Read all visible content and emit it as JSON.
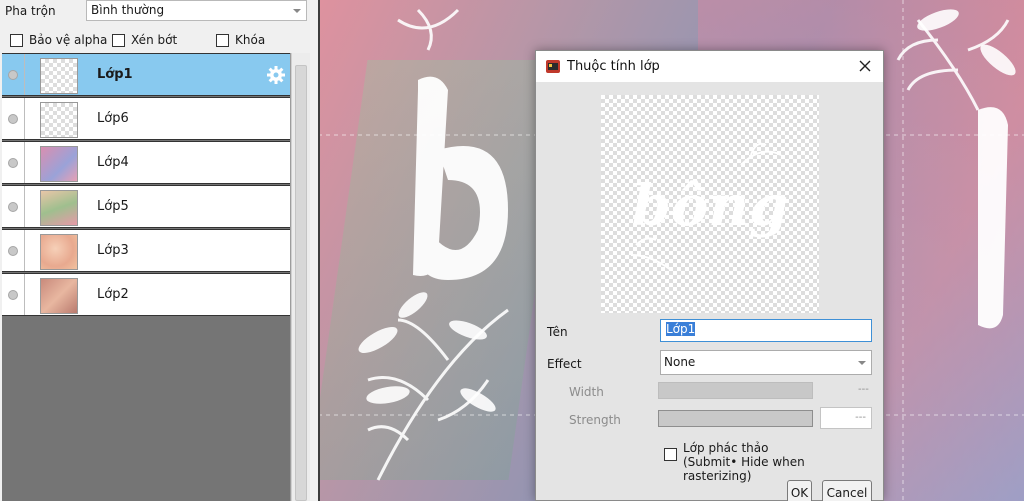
{
  "panel": {
    "blend_label": "Pha trộn",
    "blend_value": "Bình thường",
    "checks": [
      "Bảo vệ alpha",
      "Xén bớt",
      "Khóa"
    ]
  },
  "layers": [
    {
      "name": "Lớp1",
      "selected": true,
      "thumb": "checker"
    },
    {
      "name": "Lớp6",
      "selected": false,
      "thumb": "checker"
    },
    {
      "name": "Lớp4",
      "selected": false,
      "thumb": "pink-blue"
    },
    {
      "name": "Lớp5",
      "selected": false,
      "thumb": "green-pink"
    },
    {
      "name": "Lớp3",
      "selected": false,
      "thumb": "peach"
    },
    {
      "name": "Lớp2",
      "selected": false,
      "thumb": "rose"
    }
  ],
  "dialog": {
    "title": "Thuộc tính lớp",
    "preview_text": "bông",
    "name_label": "Tên",
    "name_value": "Lớp1",
    "effect_label": "Effect",
    "effect_value": "None",
    "width_label": "Width",
    "width_value": "---",
    "strength_label": "Strength",
    "strength_value": "---",
    "sketch_line1": "Lớp phác thảo",
    "sketch_line2": "(Submit• Hide when rasterizing)",
    "ok_label": "OK",
    "cancel_label": "Cancel"
  },
  "canvas": {
    "lettering": "bông"
  },
  "icons": {
    "gear": "gear-icon",
    "close": "close-icon",
    "app": "app-icon",
    "eye": "visibility-icon"
  },
  "colors": {
    "selected_row": "#88c9ef",
    "focus_border": "#3f90d6",
    "text_selection": "#3a7fd8"
  }
}
